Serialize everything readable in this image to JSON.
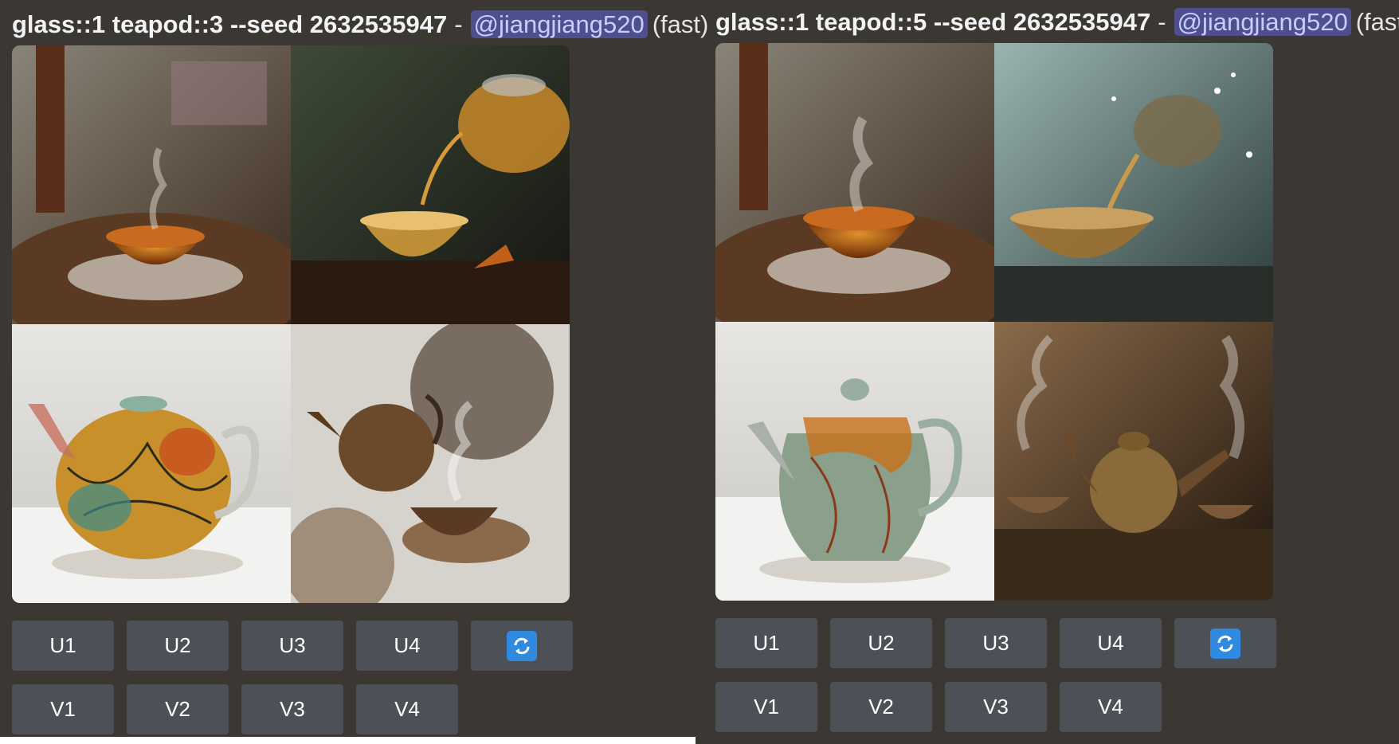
{
  "messages": [
    {
      "prompt": "glass::1 teapod::3 --seed 2632535947",
      "separator": "-",
      "mention": "@jiangjiang520",
      "speed": "(fast)",
      "upscale_buttons": [
        "U1",
        "U2",
        "U3",
        "U4"
      ],
      "variation_buttons": [
        "V1",
        "V2",
        "V3",
        "V4"
      ],
      "images": [
        "tea-cup-on-saucer",
        "teapot-pouring-into-cup",
        "stained-glass-teapot",
        "ink-splatter-teapot-and-cup"
      ]
    },
    {
      "prompt": "glass::1 teapod::5 --seed 2632535947",
      "separator": "-",
      "mention": "@jiangjiang520",
      "speed": "(fast)",
      "upscale_buttons": [
        "U1",
        "U2",
        "U3",
        "U4"
      ],
      "variation_buttons": [
        "V1",
        "V2",
        "V3",
        "V4"
      ],
      "images": [
        "tea-cup-on-saucer",
        "splashing-teapot",
        "green-glass-teapot",
        "rustic-teapot-and-cups"
      ]
    }
  ],
  "icons": {
    "reroll": "refresh-icon"
  },
  "colors": {
    "background": "#3b3833",
    "button": "#4e5058",
    "mention_bg": "#4e4f8f",
    "refresh": "#2f8ae0"
  }
}
